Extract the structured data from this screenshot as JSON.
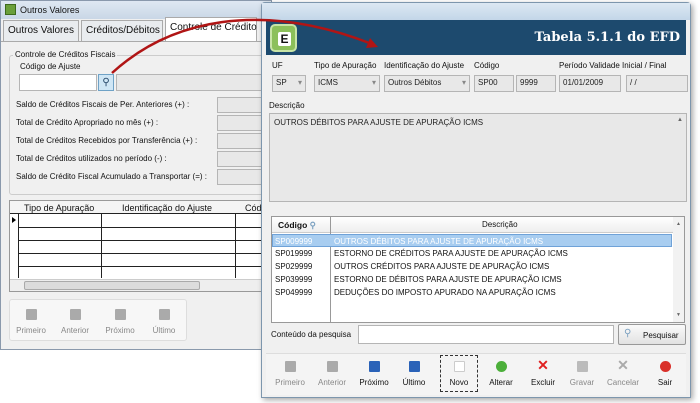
{
  "back_window": {
    "title": "Outros Valores",
    "tabs": [
      "Outros Valores",
      "Créditos/Débitos",
      "Controle de Crédito"
    ],
    "group_title": "Controle de Créditos Fiscais",
    "codigo_label": "Código de Ajuste",
    "rows": [
      "Saldo de Créditos Fiscais de Per. Anteriores (+) :",
      "Total de Crédito Apropriado no mês (+) :",
      "Total de Créditos Recebidos por Transferência (+) :",
      "Total de Créditos utilizados no período (-) :",
      "Saldo de Crédito Fiscal Acumulado a Transportar (=) :"
    ],
    "grid_headers": [
      "Tipo de Apuração",
      "Identificação do Ajuste",
      "Códi"
    ],
    "nav": [
      "Primeiro",
      "Anterior",
      "Próximo",
      "Último"
    ]
  },
  "front_window": {
    "header_title": "Tabela 5.1.1 do EFD",
    "labels": {
      "uf": "UF",
      "tipo": "Tipo de Apuração",
      "ident": "Identificação do Ajuste",
      "codigo": "Código",
      "periodo": "Período Validade Inicial / Final",
      "descricao": "Descrição"
    },
    "values": {
      "uf": "SP",
      "tipo": "ICMS",
      "ident": "Outros Débitos",
      "codigo1": "SP00",
      "codigo2": "9999",
      "inicio": "01/01/2009",
      "fim": " / /"
    },
    "descricao": "OUTROS DÉBITOS PARA AJUSTE DE APURAÇÃO ICMS",
    "grid": {
      "headers": [
        "Código",
        "Descrição"
      ],
      "rows": [
        {
          "codigo": "SP009999",
          "descricao": "OUTROS DÉBITOS PARA AJUSTE DE APURAÇÃO ICMS"
        },
        {
          "codigo": "SP019999",
          "descricao": "ESTORNO DE CRÉDITOS PARA AJUSTE DE APURAÇÃO ICMS"
        },
        {
          "codigo": "SP029999",
          "descricao": "OUTROS CRÉDITOS PARA AJUSTE DE APURAÇÃO ICMS"
        },
        {
          "codigo": "SP039999",
          "descricao": "ESTORNO DE DÉBITOS PARA AJUSTE DE APURAÇÃO ICMS"
        },
        {
          "codigo": "SP049999",
          "descricao": "DEDUÇÕES DO IMPOSTO APURADO NA APURAÇÃO ICMS"
        }
      ]
    },
    "search_label": "Conteúdo da pesquisa",
    "search_value": "",
    "search_button": "Pesquisar",
    "toolbar": [
      "Primeiro",
      "Anterior",
      "Próximo",
      "Último",
      "Novo",
      "Alterar",
      "Excluir",
      "Gravar",
      "Cancelar",
      "Sair"
    ]
  },
  "colors": {
    "header": "#1d4a6e",
    "selection": "#a8cdf0",
    "arrow": "#b01515"
  }
}
